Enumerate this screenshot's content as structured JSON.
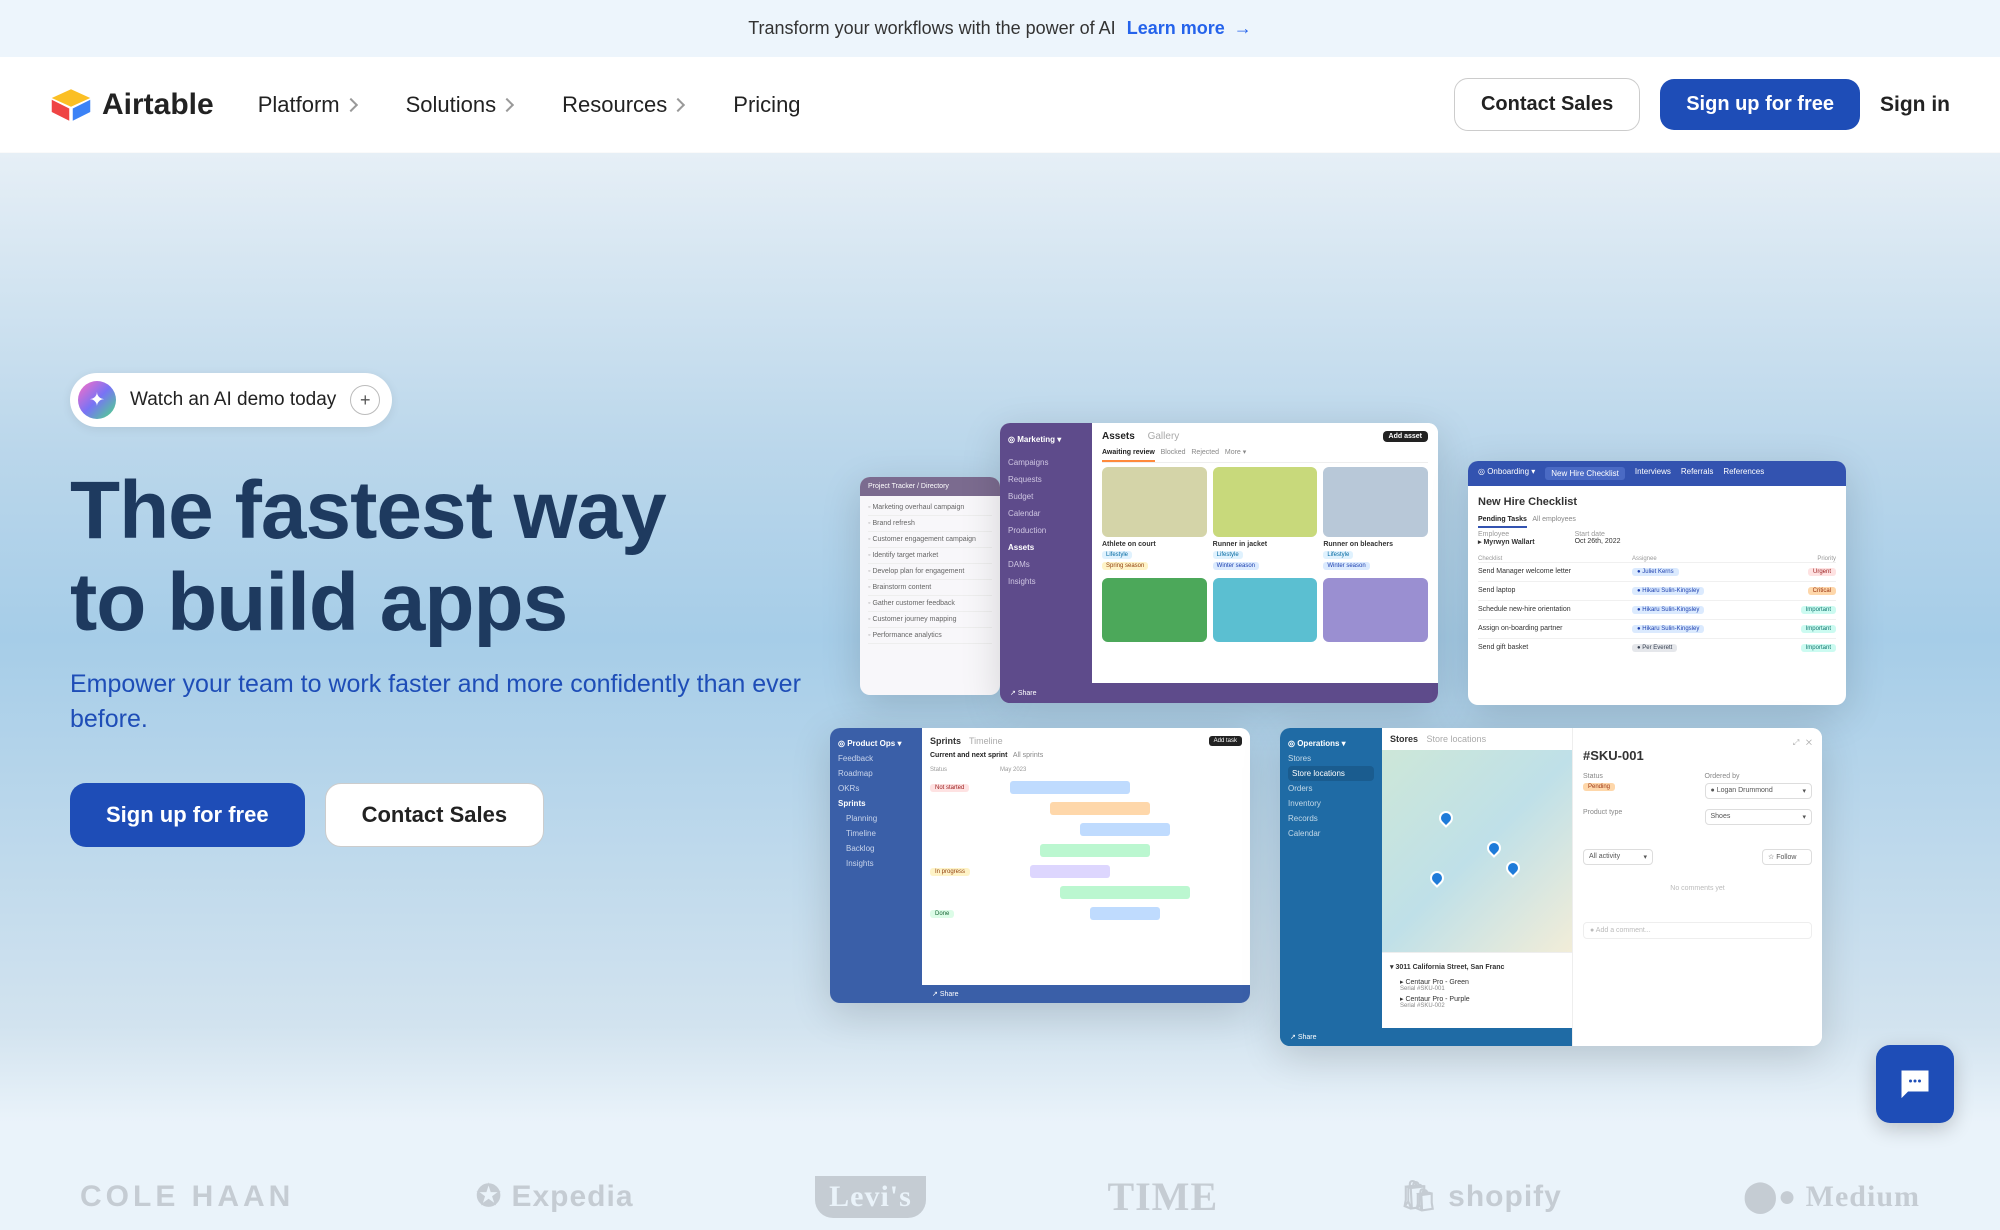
{
  "announcement": {
    "text": "Transform your workflows with the power of AI",
    "link_label": "Learn more"
  },
  "brand": "Airtable",
  "nav": {
    "platform": "Platform",
    "solutions": "Solutions",
    "resources": "Resources",
    "pricing": "Pricing"
  },
  "nav_right": {
    "contact_sales": "Contact Sales",
    "signup": "Sign up for free",
    "signin": "Sign in"
  },
  "ai_demo_label": "Watch an AI demo today",
  "hero": {
    "title_line1": "The fastest way",
    "title_line2": "to build apps",
    "subtitle": "Empower your team to work faster and more confidently than ever before.",
    "cta_primary": "Sign up for free",
    "cta_secondary": "Contact Sales"
  },
  "mockups": {
    "tracker": {
      "header": "Project Tracker / Directory",
      "items": [
        "Marketing overhaul campaign",
        "Brand refresh",
        "Customer engagement campaign",
        "Identify target market",
        "Develop plan for engagement",
        "Brainstorm content",
        "Gather customer feedback",
        "Customer journey mapping",
        "Performance analytics"
      ]
    },
    "marketing": {
      "sidebar_title": "Marketing",
      "sidebar_items": [
        "Campaigns",
        "Requests",
        "Budget",
        "Calendar",
        "Production",
        "Assets",
        "DAMs",
        "Insights"
      ],
      "tabs_active": "Assets",
      "tabs_inactive": "Gallery",
      "add_asset": "Add asset",
      "filter_active": "Awaiting review",
      "filters": [
        "Blocked",
        "Rejected",
        "More"
      ],
      "cards": [
        {
          "title": "Athlete on court",
          "tag": "Lifestyle",
          "tag2": "Spring season"
        },
        {
          "title": "Runner in jacket",
          "tag": "Lifestyle",
          "tag2": "Winter season"
        },
        {
          "title": "Runner on bleachers",
          "tag": "Lifestyle",
          "tag2": "Winter season"
        }
      ],
      "footer": "Share"
    },
    "onboarding": {
      "header_title": "Onboarding",
      "header_tabs": [
        "New Hire Checklist",
        "Interviews",
        "Referrals",
        "References"
      ],
      "title": "New Hire Checklist",
      "tabs_active": "Pending Tasks",
      "tabs_inactive": "All employees",
      "employee_label": "Employee",
      "employee": "Myrwyn Wallart",
      "start_label": "Start date",
      "start": "Oct 26th, 2022",
      "cols": [
        "Checklist",
        "Assignee",
        "Priority"
      ],
      "rows": [
        {
          "task": "Send Manager welcome letter",
          "assignee": "Juliet Kerns",
          "pri": "Urgent",
          "pri_cls": "badge-red"
        },
        {
          "task": "Send laptop",
          "assignee": "Hikaru Sulin-Kingsley",
          "pri": "Critical",
          "pri_cls": "badge-orange"
        },
        {
          "task": "Schedule new-hire orientation",
          "assignee": "Hikaru Sulin-Kingsley",
          "pri": "Important",
          "pri_cls": "badge-teal"
        },
        {
          "task": "Assign on-boarding partner",
          "assignee": "Hikaru Sulin-Kingsley",
          "pri": "Important",
          "pri_cls": "badge-teal"
        },
        {
          "task": "Send gift basket",
          "assignee": "Per Everett",
          "pri": "Important",
          "pri_cls": "badge-teal"
        }
      ]
    },
    "sprints": {
      "sidebar_title": "Product Ops",
      "sidebar_items": [
        "Feedback",
        "Roadmap",
        "OKRs",
        "Sprints",
        "Planning",
        "Timeline",
        "Backlog",
        "Insights"
      ],
      "tabs_active": "Sprints",
      "tabs_inactive": "Timeline",
      "add_task": "Add task",
      "subtitle": "Current and next sprint",
      "subtitle2": "All sprints",
      "col_status": "Status",
      "col_date": "May 2023",
      "status_notstarted": "Not started",
      "status_inprogress": "In progress",
      "status_done": "Done",
      "footer": "Share"
    },
    "ops": {
      "sidebar_title": "Operations",
      "sidebar_items": [
        "Stores",
        "Store locations",
        "Orders",
        "Inventory",
        "Records",
        "Calendar"
      ],
      "stores_label": "Stores",
      "stores_sub": "Store locations",
      "loc_title": "3011 California Street, San Franc",
      "item1": "Centaur Pro - Green",
      "item1_serial": "Serial #SKU-001",
      "item2": "Centaur Pro - Purple",
      "item2_serial": "Serial #SKU-002",
      "detail_title": "#SKU-001",
      "status_label": "Status",
      "status_value": "Pending",
      "ordered_label": "Ordered by",
      "ordered_value": "Logan Drummond",
      "product_label": "Product type",
      "product_value": "Shoes",
      "activity": "All activity",
      "follow": "Follow",
      "no_comments": "No comments yet",
      "add_comment": "Add a comment...",
      "footer": "Share"
    }
  },
  "logos": [
    "COLE HAAN",
    "Expedia",
    "Levi's",
    "TIME",
    "shopify",
    "Medium"
  ]
}
